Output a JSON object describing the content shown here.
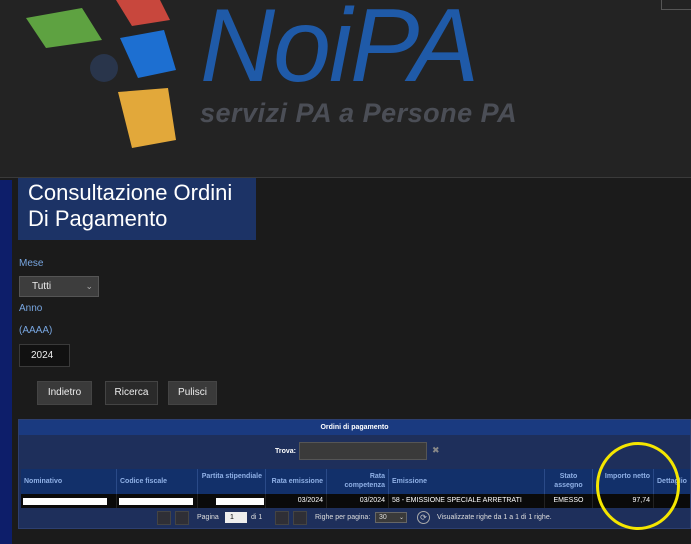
{
  "header": {
    "logo_word": "NoiPA",
    "logo_tagline": "servizi PA a Persone PA",
    "colors": {
      "logo_blue": "#1f5aa8",
      "tile_green": "#5ea241",
      "tile_red": "#c8473d",
      "tile_blue": "#1d6fd1",
      "tile_yellow": "#e2a83a"
    }
  },
  "page": {
    "title_line1": "Consultazione Ordini",
    "title_line2": "Di Pagamento"
  },
  "form": {
    "mese_label": "Mese",
    "mese_value": "Tutti",
    "anno_label": "Anno",
    "anno_format": "(AAAA)",
    "anno_value": "2024",
    "buttons": {
      "back": "Indietro",
      "search": "Ricerca",
      "clear": "Pulisci"
    }
  },
  "table": {
    "title": "Ordini di pagamento",
    "find_label": "Trova:",
    "find_clear_icon": "✖",
    "columns": {
      "nominativo": "Nominativo",
      "codice_fiscale": "Codice fiscale",
      "partita": "Partita stipendiale",
      "rata_emissione": "Rata emissione",
      "rata_competenza": "Rata competenza",
      "emissione": "Emissione",
      "stato": "Stato assegno",
      "importo": "Importo netto",
      "dettaglio": "Dettaglio"
    },
    "rows": [
      {
        "rata_emissione": "03/2024",
        "rata_competenza": "03/2024",
        "emissione": "58 - EMISSIONE SPECIALE ARRETRATI",
        "stato": "EMESSO",
        "importo": "97,74"
      }
    ],
    "pager": {
      "page_label": "Pagina",
      "page_value": "1",
      "of_label": "di 1",
      "rows_label": "Righe per pagina:",
      "rows_value": "30",
      "summary": "Visualizzate righe da 1 a 1 di 1 righe."
    }
  }
}
